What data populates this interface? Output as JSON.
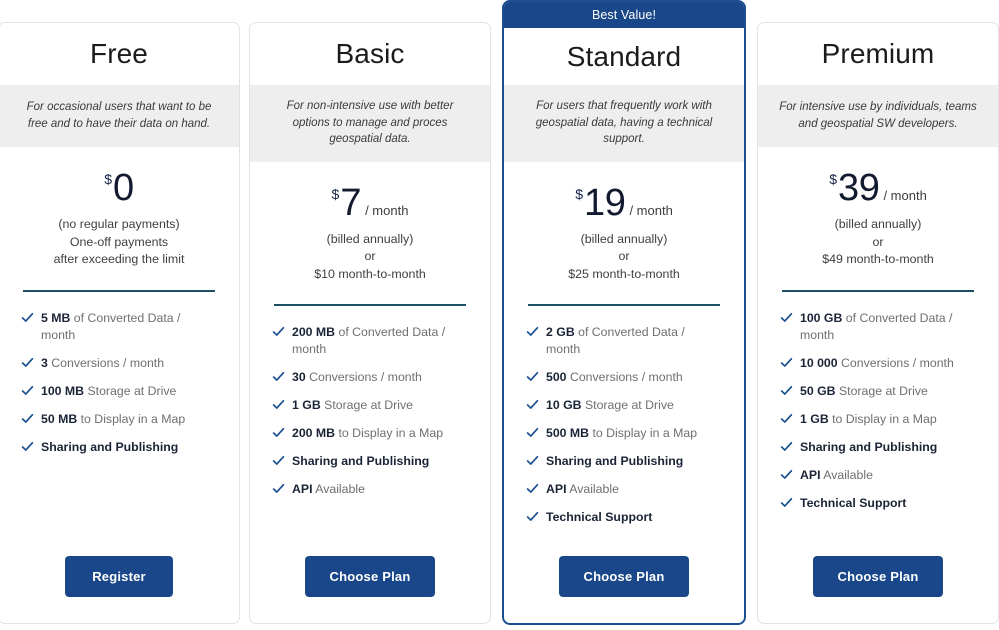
{
  "page": {
    "background": "#ffffff",
    "accent_blue": "#1a4789",
    "divider_color": "#1c4f63",
    "band_background": "#eeeeee"
  },
  "plans": [
    {
      "id": "free",
      "name": "Free",
      "featured": false,
      "banner": "",
      "description": "For occasional users that want to be free and to have their data on hand.",
      "currency": "$",
      "amount": "0",
      "period": "",
      "billing_note": "(no regular payments)\nOne-off payments\nafter exceeding the limit",
      "features": [
        {
          "value": "5 MB",
          "label": " of Converted Data / month",
          "bold": false
        },
        {
          "value": "3",
          "label": " Conversions / month",
          "bold": false
        },
        {
          "value": "100 MB",
          "label": " Storage at Drive",
          "bold": false
        },
        {
          "value": "50 MB",
          "label": " to Display in a Map",
          "bold": false
        },
        {
          "value": "Sharing and Publishing",
          "label": "",
          "bold": true
        }
      ],
      "cta_label": "Register"
    },
    {
      "id": "basic",
      "name": "Basic",
      "featured": false,
      "banner": "",
      "description": "For non-intensive use with better options to manage and proces geospatial data.",
      "currency": "$",
      "amount": "7",
      "period": "/ month",
      "billing_note": "(billed annually)\nor\n$10 month-to-month",
      "features": [
        {
          "value": "200 MB",
          "label": " of Converted Data / month",
          "bold": false
        },
        {
          "value": "30",
          "label": " Conversions / month",
          "bold": false
        },
        {
          "value": "1 GB",
          "label": " Storage at Drive",
          "bold": false
        },
        {
          "value": "200 MB",
          "label": " to Display in a Map",
          "bold": false
        },
        {
          "value": "Sharing and Publishing",
          "label": "",
          "bold": true
        },
        {
          "value": "API",
          "label": " Available",
          "bold": false
        }
      ],
      "cta_label": "Choose Plan"
    },
    {
      "id": "standard",
      "name": "Standard",
      "featured": true,
      "banner": "Best Value!",
      "description": "For users that frequently work with geospatial data, having a technical support.",
      "currency": "$",
      "amount": "19",
      "period": "/ month",
      "billing_note": "(billed annually)\nor\n$25 month-to-month",
      "features": [
        {
          "value": "2 GB",
          "label": " of Converted Data / month",
          "bold": false
        },
        {
          "value": "500",
          "label": " Conversions / month",
          "bold": false
        },
        {
          "value": "10 GB",
          "label": " Storage at Drive",
          "bold": false
        },
        {
          "value": "500 MB",
          "label": " to Display in a Map",
          "bold": false
        },
        {
          "value": "Sharing and Publishing",
          "label": "",
          "bold": true
        },
        {
          "value": "API",
          "label": " Available",
          "bold": false
        },
        {
          "value": "Technical Support",
          "label": "",
          "bold": true
        }
      ],
      "cta_label": "Choose Plan"
    },
    {
      "id": "premium",
      "name": "Premium",
      "featured": false,
      "banner": "",
      "description": "For intensive use by individuals, teams and geospatial SW developers.",
      "currency": "$",
      "amount": "39",
      "period": "/ month",
      "billing_note": "(billed annually)\nor\n$49 month-to-month",
      "features": [
        {
          "value": "100 GB",
          "label": " of Converted Data / month",
          "bold": false
        },
        {
          "value": "10 000",
          "label": " Conversions / month",
          "bold": false
        },
        {
          "value": "50 GB",
          "label": " Storage at Drive",
          "bold": false
        },
        {
          "value": "1 GB",
          "label": " to Display in a Map",
          "bold": false
        },
        {
          "value": "Sharing and Publishing",
          "label": "",
          "bold": true
        },
        {
          "value": "API",
          "label": " Available",
          "bold": false
        },
        {
          "value": "Technical Support",
          "label": "",
          "bold": true
        }
      ],
      "cta_label": "Choose Plan"
    }
  ],
  "icons": {
    "check": "check-icon"
  }
}
